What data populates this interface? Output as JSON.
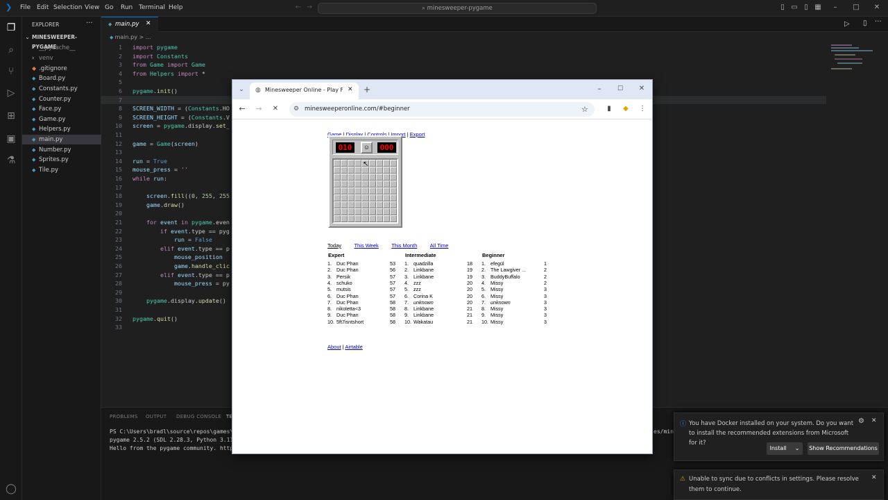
{
  "vscode": {
    "menu": [
      "File",
      "Edit",
      "Selection",
      "View",
      "Go",
      "Run",
      "Terminal",
      "Help"
    ],
    "command_center": "minesweeper-pygame",
    "explorer_title": "EXPLORER",
    "project": "MINESWEEPER-PYGAME",
    "files": [
      {
        "name": "__pycache__",
        "kind": "folder"
      },
      {
        "name": "venv",
        "kind": "folder"
      },
      {
        "name": ".gitignore",
        "kind": "file"
      },
      {
        "name": "Board.py",
        "kind": "py"
      },
      {
        "name": "Constants.py",
        "kind": "py"
      },
      {
        "name": "Counter.py",
        "kind": "py"
      },
      {
        "name": "Face.py",
        "kind": "py"
      },
      {
        "name": "Game.py",
        "kind": "py"
      },
      {
        "name": "Helpers.py",
        "kind": "py"
      },
      {
        "name": "main.py",
        "kind": "py",
        "selected": true
      },
      {
        "name": "Number.py",
        "kind": "py"
      },
      {
        "name": "Sprites.py",
        "kind": "py"
      },
      {
        "name": "Tile.py",
        "kind": "py"
      }
    ],
    "active_tab": "main.py",
    "breadcrumb": "main.py > ...",
    "code_lines": [
      "import pygame",
      "import Constants",
      "from Game import Game",
      "from Helpers import *",
      "",
      "pygame.init()",
      "",
      "SCREEN_WIDTH = (Constants.HO",
      "SCREEN_HEIGHT = (Constants.V",
      "screen = pygame.display.set_",
      "",
      "game = Game(screen)",
      "",
      "run = True",
      "mouse_press = ''",
      "while run:",
      "",
      "    screen.fill((0, 255, 255",
      "    game.draw()",
      "",
      "    for event in pygame.even",
      "        if event.type == pyg",
      "            run = False",
      "        elif event.type == p",
      "            mouse_position",
      "            game.handle_clic",
      "        elif event.type == p",
      "            mouse_press = py",
      "",
      "    pygame.display.update()",
      "",
      "pygame.quit()",
      ""
    ],
    "panel_tabs": [
      "PROBLEMS",
      "OUTPUT",
      "DEBUG CONSOLE",
      "TE"
    ],
    "terminal_lines": [
      "PS C:\\Users\\bradl\\source\\repos\\games\\",
      "pygame 2.5.2 (SDL 2.28.3, Python 3.11.",
      "Hello from the pygame community. https"
    ],
    "terminal_right": "es/mine:",
    "notifications": [
      {
        "text": "You have Docker installed on your system. Do you want to install the recommended extensions from Microsoft for it?",
        "buttons": [
          "Install",
          "Show Recommendations"
        ]
      },
      {
        "text": "Unable to sync due to conflicts in settings. Please resolve them to continue."
      }
    ]
  },
  "browser": {
    "tab_title": "Minesweeper Online - Play Free",
    "url": "minesweeperonline.com/#beginner",
    "top_links": [
      "Game",
      "Display",
      "Controls",
      "Import",
      "Export"
    ],
    "mines_counter": "010",
    "timer": "000",
    "grid_size": 9,
    "periods": [
      "Today",
      "This Week",
      "This Month",
      "All Time"
    ],
    "scores": [
      {
        "title": "Expert",
        "rows": [
          [
            "1.",
            "Duc Phan",
            "53"
          ],
          [
            "2.",
            "Duc Phan",
            "56"
          ],
          [
            "3.",
            "Persik",
            "57"
          ],
          [
            "4.",
            "schuko",
            "57"
          ],
          [
            "5.",
            "mutsis",
            "57"
          ],
          [
            "6.",
            "Duc Phan",
            "57"
          ],
          [
            "7.",
            "Duc Phan",
            "58"
          ],
          [
            "8.",
            "nikoletta<3",
            "58"
          ],
          [
            "9.",
            "Duc Phan",
            "58"
          ],
          [
            "10.",
            "5ft7isntshort",
            "58"
          ]
        ]
      },
      {
        "title": "Intermediate",
        "rows": [
          [
            "1.",
            "quadzilla",
            "18"
          ],
          [
            "2.",
            "Linkbane",
            "19"
          ],
          [
            "3.",
            "Linkbane",
            "19"
          ],
          [
            "4.",
            "zzz",
            "20"
          ],
          [
            "5.",
            "zzz",
            "20"
          ],
          [
            "6.",
            "Corina K",
            "20"
          ],
          [
            "7.",
            "unknown",
            "20"
          ],
          [
            "8.",
            "Linkbane",
            "21"
          ],
          [
            "9.",
            "Linkbane",
            "21"
          ],
          [
            "10.",
            "Wakatau",
            "21"
          ]
        ]
      },
      {
        "title": "Beginner",
        "rows": [
          [
            "1.",
            "efegül",
            "1"
          ],
          [
            "2.",
            "The Lawgiver ...",
            "2"
          ],
          [
            "3.",
            "BuddyBuffalo",
            "2"
          ],
          [
            "4.",
            "Missy",
            "2"
          ],
          [
            "5.",
            "Missy",
            "3"
          ],
          [
            "6.",
            "Missy",
            "3"
          ],
          [
            "7.",
            "unknown",
            "3"
          ],
          [
            "8.",
            "Missy",
            "3"
          ],
          [
            "9.",
            "Missy",
            "3"
          ],
          [
            "10.",
            "Missy",
            "3"
          ]
        ]
      }
    ],
    "bottom_links": [
      "About",
      "Airtable"
    ]
  },
  "colors": {
    "accent": "#0078d4",
    "link": "#0000cc",
    "lcd_red": "#ff0000",
    "tile": "#c0c0c0"
  }
}
